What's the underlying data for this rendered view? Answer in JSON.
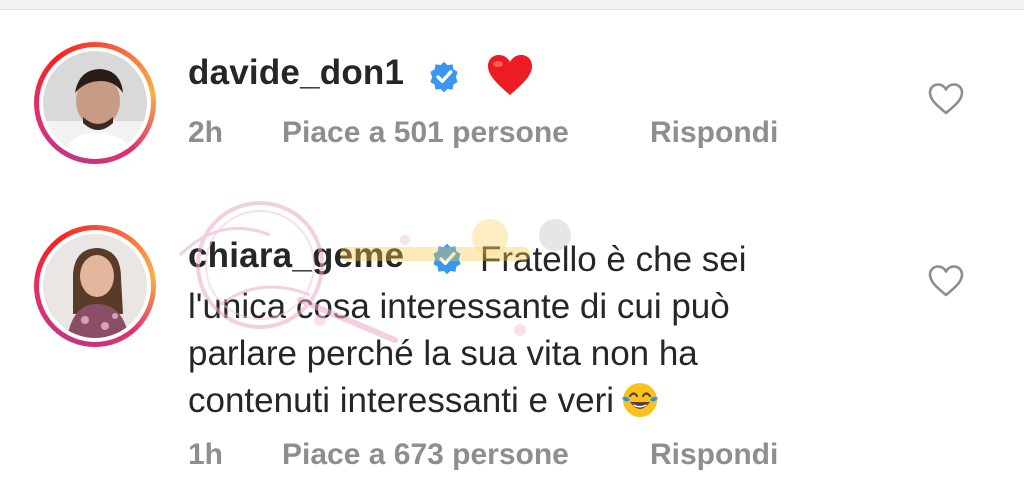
{
  "comments": [
    {
      "username": "davide_don1",
      "verified": true,
      "emoji": "red-heart",
      "text": "",
      "time": "2h",
      "likes_text": "Piace a 501 persone",
      "reply_label": "Rispondi"
    },
    {
      "username": "chiara_geme",
      "verified": true,
      "text": "Fratello è che sei l'unica cosa interessante di cui può parlare perché la sua vita non ha contenuti interessanti e veri",
      "emoji": "face-with-tears-of-joy",
      "time": "1h",
      "likes_text": "Piace a 673 persone",
      "reply_label": "Rispondi"
    }
  ],
  "colors": {
    "text": "#262626",
    "meta": "#8e8e8e",
    "verified": "#3897f0",
    "heart": "#ed1c24",
    "watermark": "#e8a9c9"
  }
}
